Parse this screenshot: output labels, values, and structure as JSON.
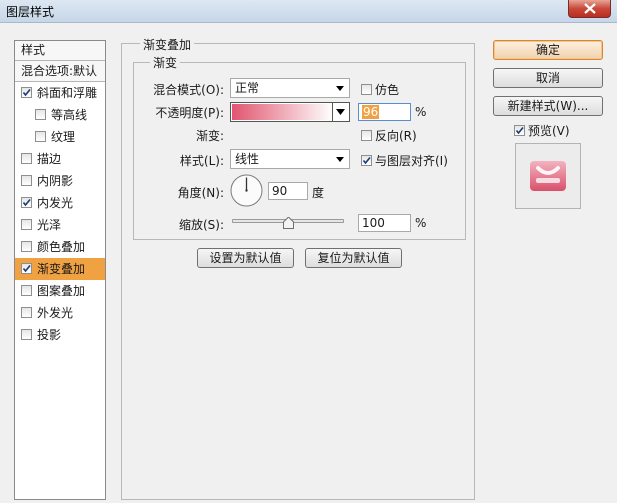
{
  "window": {
    "title": "图层样式"
  },
  "stylelist": {
    "header": "样式",
    "blend_options": "混合选项:默认",
    "items": [
      {
        "label": "斜面和浮雕",
        "checked": true,
        "indent": false,
        "selected": false
      },
      {
        "label": "等高线",
        "checked": false,
        "indent": true,
        "selected": false
      },
      {
        "label": "纹理",
        "checked": false,
        "indent": true,
        "selected": false
      },
      {
        "label": "描边",
        "checked": false,
        "indent": false,
        "selected": false
      },
      {
        "label": "内阴影",
        "checked": false,
        "indent": false,
        "selected": false
      },
      {
        "label": "内发光",
        "checked": true,
        "indent": false,
        "selected": false
      },
      {
        "label": "光泽",
        "checked": false,
        "indent": false,
        "selected": false
      },
      {
        "label": "颜色叠加",
        "checked": false,
        "indent": false,
        "selected": false
      },
      {
        "label": "渐变叠加",
        "checked": true,
        "indent": false,
        "selected": true
      },
      {
        "label": "图案叠加",
        "checked": false,
        "indent": false,
        "selected": false
      },
      {
        "label": "外发光",
        "checked": false,
        "indent": false,
        "selected": false
      },
      {
        "label": "投影",
        "checked": false,
        "indent": false,
        "selected": false
      }
    ]
  },
  "panel": {
    "title": "渐变叠加",
    "group_title": "渐变",
    "blend_mode": {
      "label": "混合模式(O):",
      "value": "正常"
    },
    "dither": {
      "label": "仿色",
      "checked": false
    },
    "opacity": {
      "label": "不透明度(P):",
      "value": "96",
      "unit": "%",
      "level": 0.96
    },
    "gradient": {
      "label": "渐变:",
      "colors": [
        "#e0566f",
        "#ffffff"
      ]
    },
    "reverse": {
      "label": "反向(R)",
      "checked": false
    },
    "style": {
      "label": "样式(L):",
      "value": "线性"
    },
    "align_layer": {
      "label": "与图层对齐(I)",
      "checked": true
    },
    "angle": {
      "label": "角度(N):",
      "value": "90",
      "unit": "度",
      "degrees": 90
    },
    "scale": {
      "label": "缩放(S):",
      "value": "100",
      "unit": "%",
      "level": 0.5
    },
    "set_default_button": "设置为默认值",
    "reset_default_button": "复位为默认值"
  },
  "buttons": {
    "ok": "确定",
    "cancel": "取消",
    "new_style": "新建样式(W)...",
    "preview": {
      "label": "预览(V)",
      "checked": true
    }
  },
  "colors": {
    "selection": "#f0a243",
    "gradient_pink": "#e0566f",
    "preview_pink": "#e48395"
  }
}
